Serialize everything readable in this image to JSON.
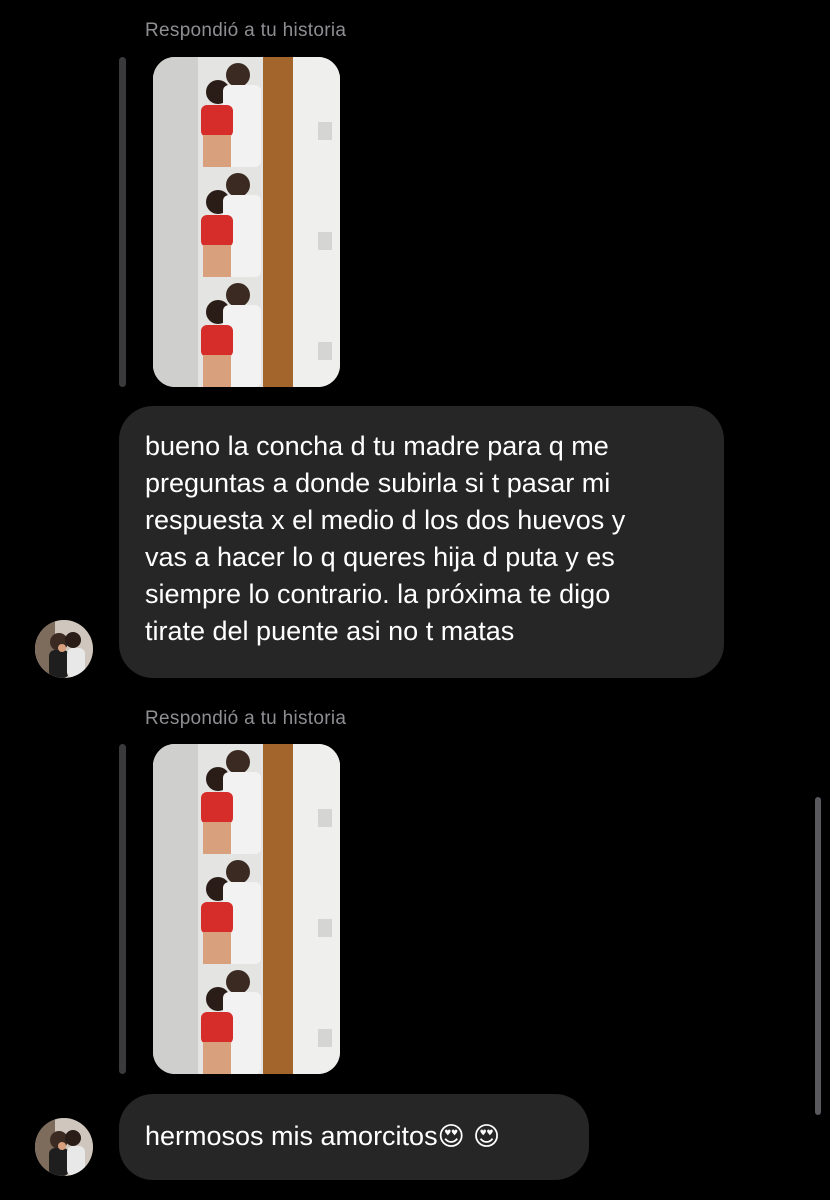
{
  "messages": [
    {
      "reply_label": "Respondió a tu historia",
      "type": "story_reply",
      "text_lines": [
        "bueno la concha d tu madre para q me",
        "preguntas a donde subirla si t pasar mi",
        "respuesta x el medio d los dos huevos y",
        "vas a hacer lo q queres hija d puta y es",
        "siempre lo contrario. la próxima te digo",
        "tirate del puente asi no t matas"
      ]
    },
    {
      "reply_label": "Respondió a tu historia",
      "type": "story_reply",
      "text": "hermosos mis amorcitos",
      "emojis": "😍 😍"
    }
  ],
  "icons": {
    "avatar": "avatar-icon",
    "emoji": "heart-eyes-emoji"
  },
  "colors": {
    "background": "#000000",
    "bubble": "#262626",
    "label": "#8e8e93"
  }
}
